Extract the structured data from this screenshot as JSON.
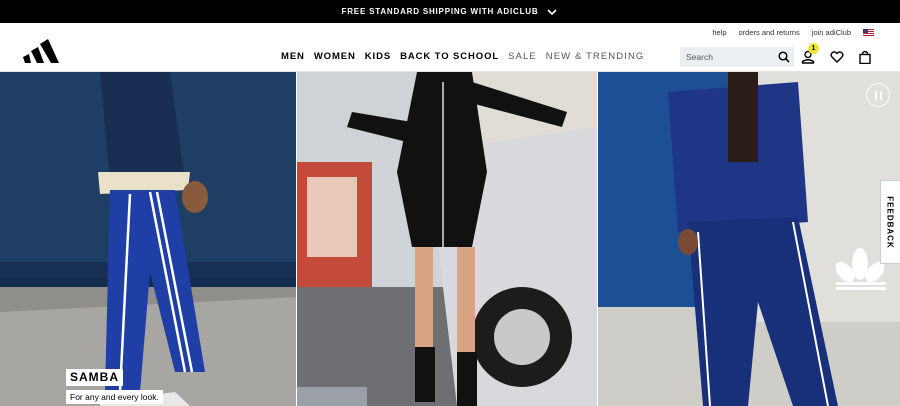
{
  "promo": {
    "text": "FREE STANDARD SHIPPING WITH ADICLUB"
  },
  "utility_links": [
    "help",
    "orders and returns",
    "join adiClub"
  ],
  "nav": [
    "MEN",
    "WOMEN",
    "KIDS",
    "BACK TO SCHOOL",
    "SALE",
    "NEW & TRENDING"
  ],
  "search": {
    "placeholder": "Search"
  },
  "account": {
    "badge_count": "1"
  },
  "hero": {
    "title": "SAMBA",
    "subtitle": "For any and every look."
  },
  "feedback": {
    "label": "FEEDBACK"
  },
  "colors": {
    "promo_bg": "#000000",
    "badge": "#ede734",
    "search_bg": "#eceff1",
    "sale_text": "#555555"
  }
}
